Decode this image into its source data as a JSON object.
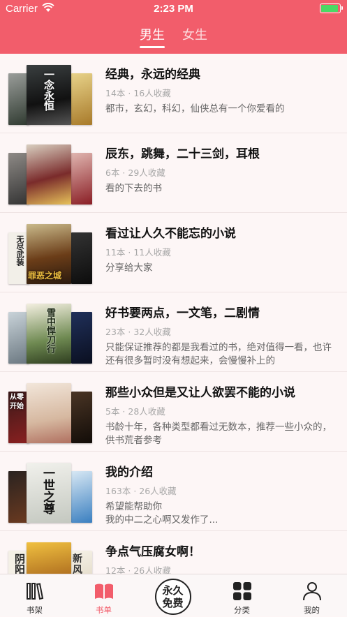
{
  "status_bar": {
    "carrier": "Carrier",
    "time": "2:23 PM"
  },
  "header": {
    "tabs": [
      {
        "label": "男生",
        "active": true
      },
      {
        "label": "女生",
        "active": false
      }
    ]
  },
  "booklists": [
    {
      "title": "经典，永远的经典",
      "meta": "14本 · 16人收藏",
      "desc": "都市，玄幻，科幻，仙侠总有一个你爱看的"
    },
    {
      "title": "辰东，跳舞，二十三剑，耳根",
      "meta": "6本 · 29人收藏",
      "desc": "看的下去的书"
    },
    {
      "title": "看过让人久不能忘的小说",
      "meta": "11本 · 11人收藏",
      "desc": "分享给大家"
    },
    {
      "title": "好书要两点，一文笔，二剧情",
      "meta": "23本 · 32人收藏",
      "desc": "只能保证推荐的都是我看过的书，绝对值得一看，也许还有很多暂时没有想起来，会慢慢补上的"
    },
    {
      "title": "那些小众但是又让人欲罢不能的小说",
      "meta": "5本 · 28人收藏",
      "desc": "书龄十年，各种类型都看过无数本，推荐一些小众的，供书荒者参考"
    },
    {
      "title": "我的介绍",
      "meta": "163本 · 26人收藏",
      "desc": "希望能帮助你\n我的中二之心啊又发作了..."
    },
    {
      "title": "争点气压腐女啊！",
      "meta": "12本 · 26人收藏",
      "desc": ""
    }
  ],
  "cover_texts": {
    "c0": "一念永恒",
    "c2l": "无尽武装",
    "c2m": "罪恶之城",
    "c3m": "雪中悍刀行",
    "c4l": "从零开始",
    "c5m": "一世之尊",
    "c6l": "阴阳",
    "c6m": "新风"
  },
  "tabbar": {
    "items": [
      {
        "label": "书架",
        "icon": "bookshelf-icon",
        "active": false
      },
      {
        "label": "书单",
        "icon": "open-book-icon",
        "active": true
      },
      {
        "label": "永久免费",
        "icon": "free-badge-icon",
        "active": false
      },
      {
        "label": "分类",
        "icon": "category-grid-icon",
        "active": false
      },
      {
        "label": "我的",
        "icon": "person-icon",
        "active": false
      }
    ]
  },
  "colors": {
    "accent": "#f25d6b",
    "battery": "#4cd964"
  }
}
